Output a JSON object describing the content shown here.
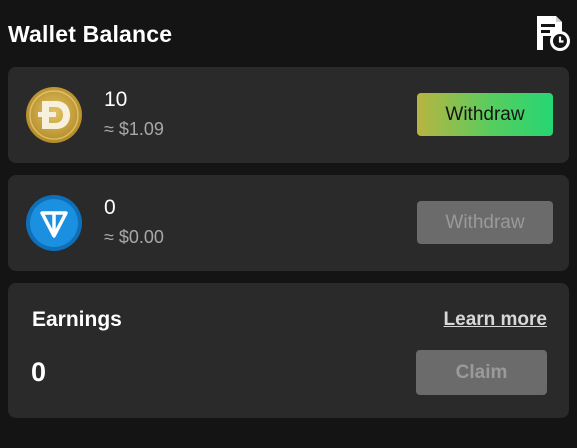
{
  "header": {
    "title": "Wallet Balance",
    "history_icon": "transaction-history-icon"
  },
  "balances": [
    {
      "coin_icon": "dogecoin-icon",
      "amount": "10",
      "fiat": "≈ $1.09",
      "withdraw_label": "Withdraw",
      "withdraw_enabled": true
    },
    {
      "coin_icon": "toncoin-icon",
      "amount": "0",
      "fiat": "≈ $0.00",
      "withdraw_label": "Withdraw",
      "withdraw_enabled": false
    }
  ],
  "earnings": {
    "label": "Earnings",
    "learn_more": "Learn more",
    "value": "0",
    "claim_label": "Claim",
    "claim_enabled": false
  },
  "colors": {
    "background": "#141414",
    "card": "#2a2a2a",
    "accent_gradient_start": "#b9b440",
    "accent_gradient_end": "#25d673",
    "disabled_button": "#6b6b6b",
    "secondary_text": "#a8a8a8",
    "ton_blue": "#1b8fe0",
    "doge_gold": "#c9a83e"
  }
}
